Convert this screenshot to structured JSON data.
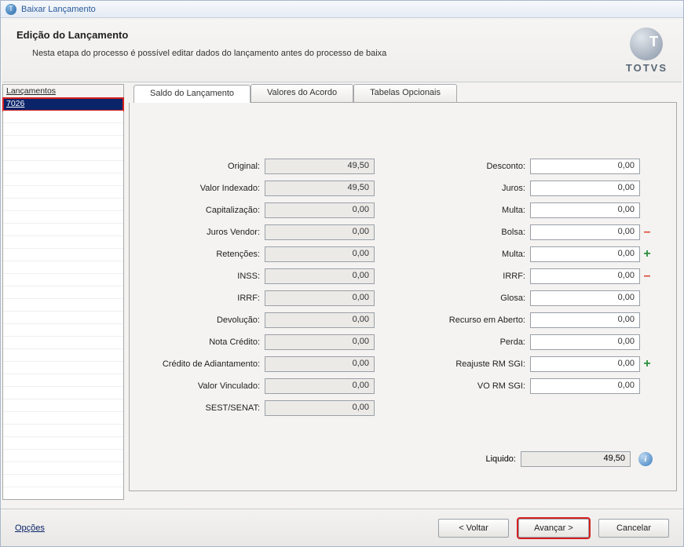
{
  "window": {
    "title": "Baixar Lançamento"
  },
  "header": {
    "title": "Edição do Lançamento",
    "subtitle": "Nesta etapa do processo é possível editar dados do lançamento antes do processo de baixa"
  },
  "logo": {
    "text": "TOTVS"
  },
  "sidebar": {
    "header": "Lançamentos",
    "items": [
      {
        "id": "7026",
        "selected": true
      }
    ]
  },
  "tabs": [
    {
      "label": "Saldo do Lançamento",
      "active": true
    },
    {
      "label": "Valores do Acordo",
      "active": false
    },
    {
      "label": "Tabelas Opcionais",
      "active": false
    }
  ],
  "left_fields": [
    {
      "label": "Original:",
      "value": "49,50",
      "editable": false
    },
    {
      "label": "Valor Indexado:",
      "value": "49,50",
      "editable": false
    },
    {
      "label": "Capitalização:",
      "value": "0,00",
      "editable": false
    },
    {
      "label": "Juros Vendor:",
      "value": "0,00",
      "editable": false
    },
    {
      "label": "Retenções:",
      "value": "0,00",
      "editable": false
    },
    {
      "label": "INSS:",
      "value": "0,00",
      "editable": false
    },
    {
      "label": "IRRF:",
      "value": "0,00",
      "editable": false
    },
    {
      "label": "Devolução:",
      "value": "0,00",
      "editable": false
    },
    {
      "label": "Nota Crédito:",
      "value": "0,00",
      "editable": false
    },
    {
      "label": "Crédito de Adiantamento:",
      "value": "0,00",
      "editable": false
    },
    {
      "label": "Valor Vinculado:",
      "value": "0,00",
      "editable": false
    },
    {
      "label": "SEST/SENAT:",
      "value": "0,00",
      "editable": false
    }
  ],
  "right_fields": [
    {
      "label": "Desconto:",
      "value": "0,00",
      "editable": true,
      "sym": ""
    },
    {
      "label": "Juros:",
      "value": "0,00",
      "editable": true,
      "sym": ""
    },
    {
      "label": "Multa:",
      "value": "0,00",
      "editable": true,
      "sym": ""
    },
    {
      "label": "Bolsa:",
      "value": "0,00",
      "editable": true,
      "sym": "minus"
    },
    {
      "label": "Multa:",
      "value": "0,00",
      "editable": true,
      "sym": "plus"
    },
    {
      "label": "IRRF:",
      "value": "0,00",
      "editable": true,
      "sym": "minus"
    },
    {
      "label": "Glosa:",
      "value": "0,00",
      "editable": true,
      "sym": ""
    },
    {
      "label": "Recurso em Aberto:",
      "value": "0,00",
      "editable": true,
      "sym": ""
    },
    {
      "label": "Perda:",
      "value": "0,00",
      "editable": true,
      "sym": ""
    },
    {
      "label": "Reajuste RM SGI:",
      "value": "0,00",
      "editable": true,
      "sym": "plus"
    },
    {
      "label": "VO RM SGI:",
      "value": "0,00",
      "editable": true,
      "sym": ""
    }
  ],
  "liquido": {
    "label": "Liquido:",
    "value": "49,50"
  },
  "footer": {
    "options": "Opções",
    "back": "< Voltar",
    "next": "Avançar >",
    "cancel": "Cancelar"
  }
}
